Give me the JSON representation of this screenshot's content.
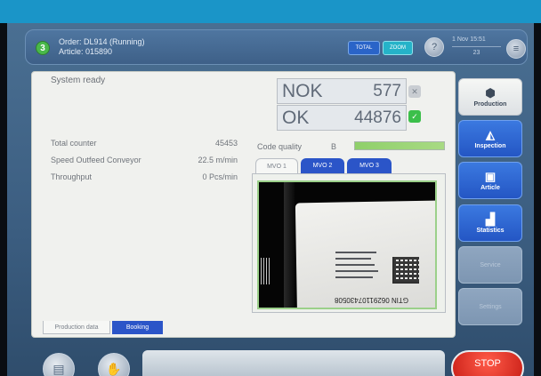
{
  "header": {
    "order_badge": "3",
    "order_line": "Order: DL914 (Running)",
    "article_line": "Article: 015890",
    "btn1_label": "TOTAL",
    "btn2_label": "ZOOM",
    "datetime": "1 Nov 15:51",
    "datetime_sub": "23"
  },
  "status": {
    "system_state": "System ready"
  },
  "counters": {
    "nok_label": "NOK",
    "nok_value": "577",
    "ok_label": "OK",
    "ok_value": "44876"
  },
  "stats": [
    {
      "label": "Total counter",
      "value": "45453"
    },
    {
      "label": "Speed Outfeed Conveyor",
      "value": "22.5 m/min"
    },
    {
      "label": "Throughput",
      "value": "0 Pcs/min"
    }
  ],
  "code_quality": {
    "label": "Code quality",
    "grade": "B",
    "level": 1.0,
    "bar_color": "#8fd06a"
  },
  "mvo_tabs": [
    {
      "label": "MVO 1",
      "active": true
    },
    {
      "label": "MVO 2",
      "active": false
    },
    {
      "label": "MVO 3",
      "active": false
    }
  ],
  "camera": {
    "gtin_text": "GTIN 06291107430508"
  },
  "bottom_tabs": [
    {
      "label": "Production data",
      "active": true
    },
    {
      "label": "Booking",
      "active": false
    }
  ],
  "nav": [
    {
      "label": "Production",
      "icon": "production-icon",
      "state": "active"
    },
    {
      "label": "Inspection",
      "icon": "inspection-icon",
      "state": "enabled"
    },
    {
      "label": "Article",
      "icon": "article-icon",
      "state": "enabled"
    },
    {
      "label": "Statistics",
      "icon": "statistics-icon",
      "state": "enabled"
    },
    {
      "label": "Service",
      "icon": "",
      "state": "disabled"
    },
    {
      "label": "Settings",
      "icon": "",
      "state": "disabled"
    }
  ],
  "controls": {
    "stop_label": "STOP"
  },
  "colors": {
    "bezel": "#1a95c8",
    "accent_blue": "#2b55c8",
    "ok_green": "#3bbf4a",
    "stop_red": "#d8291e"
  }
}
